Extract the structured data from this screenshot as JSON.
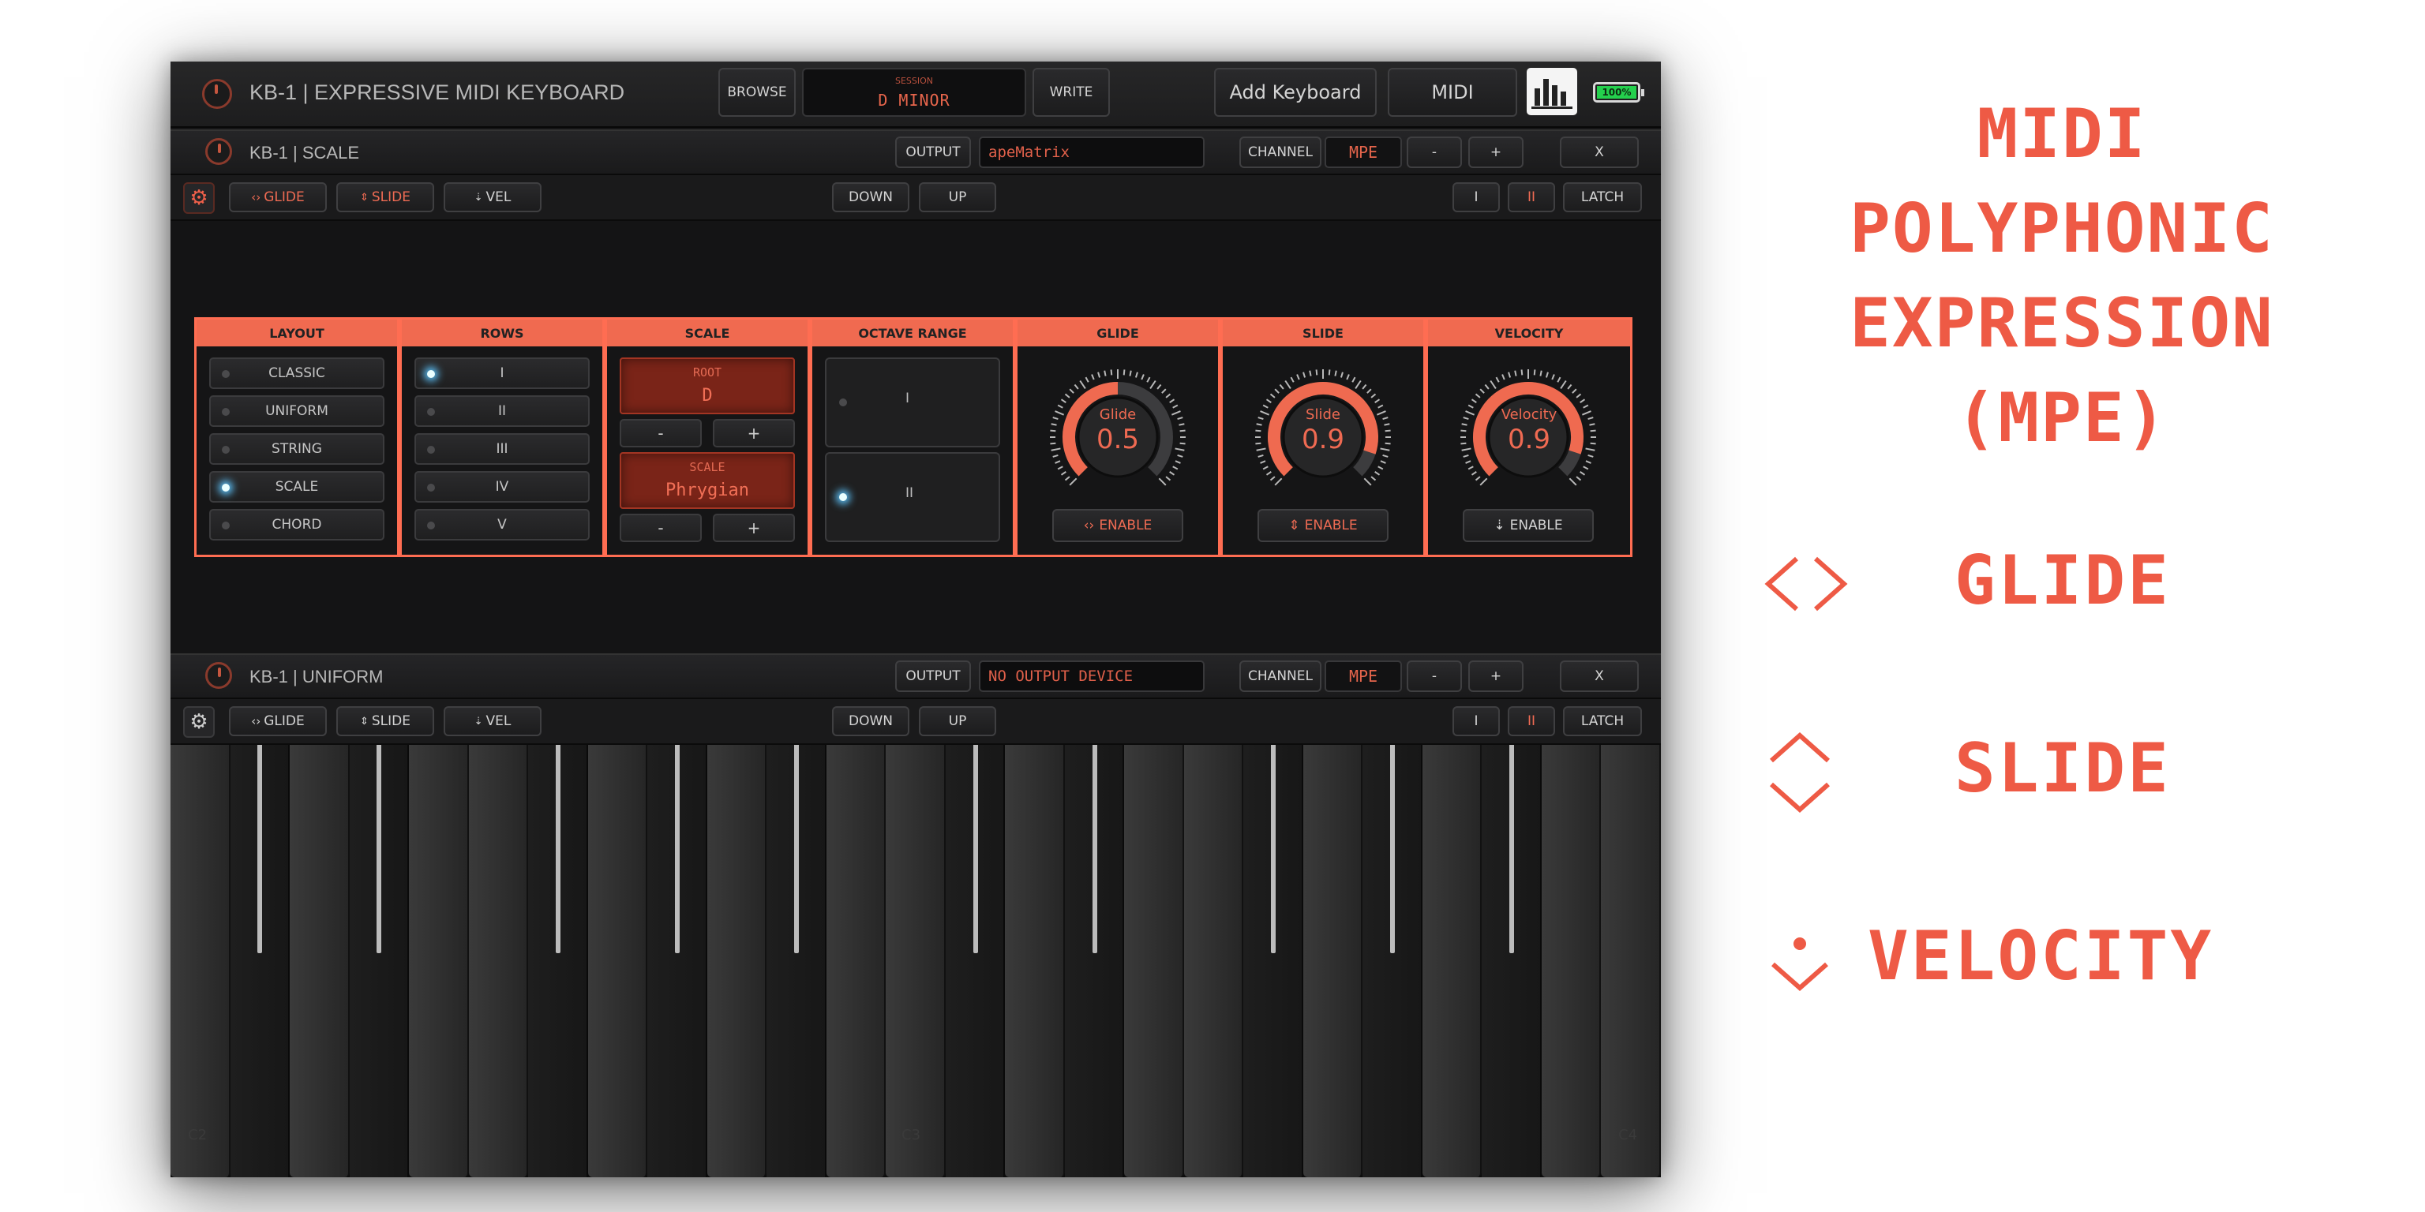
{
  "app": {
    "title": "KB-1 | EXPRESSIVE MIDI KEYBOARD",
    "browse_label": "BROWSE",
    "session_label": "SESSION",
    "session_value": "D MINOR",
    "write_label": "WRITE",
    "add_keyboard_label": "Add Keyboard",
    "midi_label": "MIDI",
    "battery": "100%"
  },
  "kb1": {
    "title": "KB-1 | SCALE",
    "output_label": "OUTPUT",
    "output_value": "apeMatrix",
    "channel_label": "CHANNEL",
    "channel_value": "MPE",
    "minus": "-",
    "plus": "+",
    "close": "X",
    "toolbar": {
      "glide": "GLIDE",
      "slide": "SLIDE",
      "vel": "VEL",
      "down": "DOWN",
      "up": "UP",
      "one": "I",
      "two": "II",
      "latch": "LATCH"
    }
  },
  "settings": {
    "layout": {
      "header": "LAYOUT",
      "options": [
        "CLASSIC",
        "UNIFORM",
        "STRING",
        "SCALE",
        "CHORD"
      ],
      "selected": 3
    },
    "rows": {
      "header": "ROWS",
      "options": [
        "I",
        "II",
        "III",
        "IV",
        "V"
      ],
      "selected": 0
    },
    "scale": {
      "header": "SCALE",
      "root_label": "ROOT",
      "root_value": "D",
      "scale_label": "SCALE",
      "scale_value": "Phrygian",
      "minus": "-",
      "plus": "+"
    },
    "octave_range": {
      "header": "OCTAVE RANGE",
      "options": [
        "I",
        "II"
      ],
      "selected": 1
    },
    "glide": {
      "header": "GLIDE",
      "knob_label": "Glide",
      "value": "0.5",
      "level": 0.5,
      "enable": "ENABLE"
    },
    "slide": {
      "header": "SLIDE",
      "knob_label": "Slide",
      "value": "0.9",
      "level": 0.9,
      "enable": "ENABLE"
    },
    "velocity": {
      "header": "VELOCITY",
      "knob_label": "Velocity",
      "value": "0.9",
      "level": 0.9,
      "enable": "ENABLE"
    }
  },
  "kb2": {
    "title": "KB-1 | UNIFORM",
    "output_label": "OUTPUT",
    "output_value": "NO OUTPUT DEVICE",
    "channel_label": "CHANNEL",
    "channel_value": "MPE",
    "minus": "-",
    "plus": "+",
    "close": "X",
    "toolbar": {
      "glide": "GLIDE",
      "slide": "SLIDE",
      "vel": "VEL",
      "down": "DOWN",
      "up": "UP",
      "one": "I",
      "two": "II",
      "latch": "LATCH"
    },
    "note_labels": [
      "C2",
      "C3",
      "C4"
    ]
  },
  "side": {
    "title_lines": [
      "MIDI",
      "POLYPHONIC",
      "EXPRESSION",
      "(MPE)"
    ],
    "glide": "GLIDE",
    "slide": "SLIDE",
    "velocity": "VELOCITY"
  },
  "colors": {
    "accent": "#f06a50",
    "panel": "#151516",
    "led": "#5ec6ff",
    "side_text": "#ee5a45"
  },
  "icons": [
    "power-logo-icon",
    "bar-meter-icon",
    "battery-icon",
    "gear-icon",
    "glide-arrows-icon",
    "slide-arrows-icon",
    "velocity-dot-arrow-icon"
  ]
}
